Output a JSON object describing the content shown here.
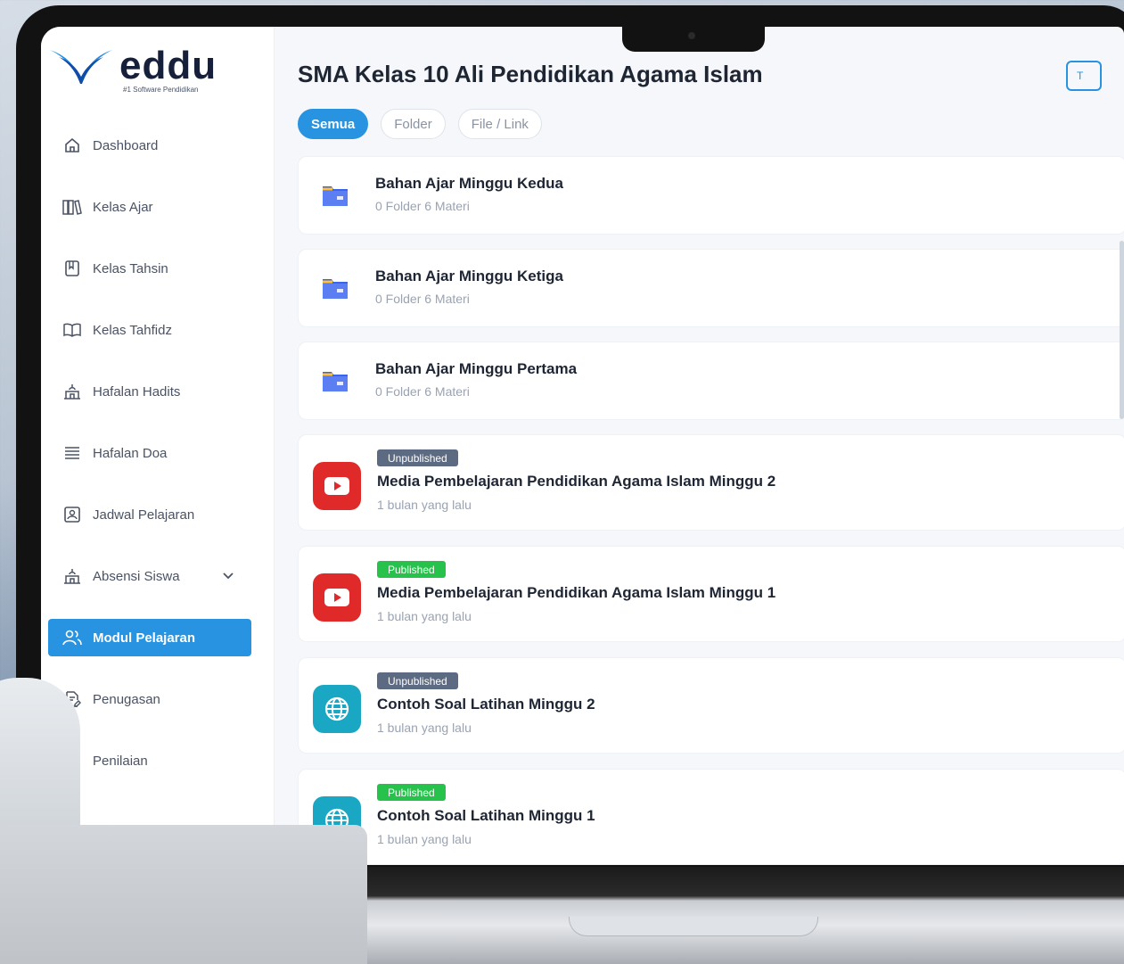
{
  "brand": {
    "name": "eddu",
    "tagline": "#1 Software Pendidikan",
    "primary_color": "#2893e0"
  },
  "sidebar": {
    "items": [
      {
        "label": "Dashboard",
        "icon": "home-icon"
      },
      {
        "label": "Kelas Ajar",
        "icon": "books-icon"
      },
      {
        "label": "Kelas Tahsin",
        "icon": "notebook-icon"
      },
      {
        "label": "Kelas Tahfidz",
        "icon": "open-book-icon"
      },
      {
        "label": "Hafalan Hadits",
        "icon": "mosque-icon"
      },
      {
        "label": "Hafalan Doa",
        "icon": "list-lines-icon"
      },
      {
        "label": "Jadwal Pelajaran",
        "icon": "id-card-icon"
      },
      {
        "label": "Absensi Siswa",
        "icon": "mosque-icon",
        "chevron": "chevron-down-icon"
      },
      {
        "label": "Modul Pelajaran",
        "icon": "users-icon",
        "active": true
      },
      {
        "label": "Penugasan",
        "icon": "document-edit-icon"
      },
      {
        "label": "Penilaian",
        "icon": "numbered-list-icon"
      }
    ]
  },
  "main": {
    "title": "SMA Kelas 10 Ali Pendidikan Agama Islam",
    "top_button": "T",
    "filters": [
      {
        "label": "Semua",
        "active": true
      },
      {
        "label": "Folder",
        "active": false
      },
      {
        "label": "File / Link",
        "active": false
      }
    ],
    "items": [
      {
        "kind": "folder",
        "title": "Bahan Ajar Minggu Kedua",
        "sub": "0 Folder  6 Materi",
        "icon": "folder-icon"
      },
      {
        "kind": "folder",
        "title": "Bahan Ajar Minggu Ketiga",
        "sub": "0 Folder  6 Materi",
        "icon": "folder-icon"
      },
      {
        "kind": "folder",
        "title": "Bahan Ajar Minggu Pertama",
        "sub": "0 Folder  6 Materi",
        "icon": "folder-icon"
      },
      {
        "kind": "youtube",
        "badge": "Unpublished",
        "title": "Media Pembelajaran Pendidikan Agama Islam Minggu 2",
        "sub": "1 bulan yang lalu",
        "icon": "youtube-icon"
      },
      {
        "kind": "youtube",
        "badge": "Published",
        "title": "Media Pembelajaran Pendidikan Agama Islam Minggu 1",
        "sub": "1 bulan yang lalu",
        "icon": "youtube-icon"
      },
      {
        "kind": "web",
        "badge": "Unpublished",
        "title": "Contoh Soal Latihan Minggu 2",
        "sub": "1 bulan yang lalu",
        "icon": "globe-icon"
      },
      {
        "kind": "web",
        "badge": "Published",
        "title": "Contoh Soal Latihan Minggu 1",
        "sub": "1 bulan yang lalu",
        "icon": "globe-icon"
      }
    ]
  },
  "colors": {
    "published": "#27c24c",
    "unpublished": "#5d6b82",
    "youtube": "#e02a2a",
    "web": "#19a7c4"
  }
}
